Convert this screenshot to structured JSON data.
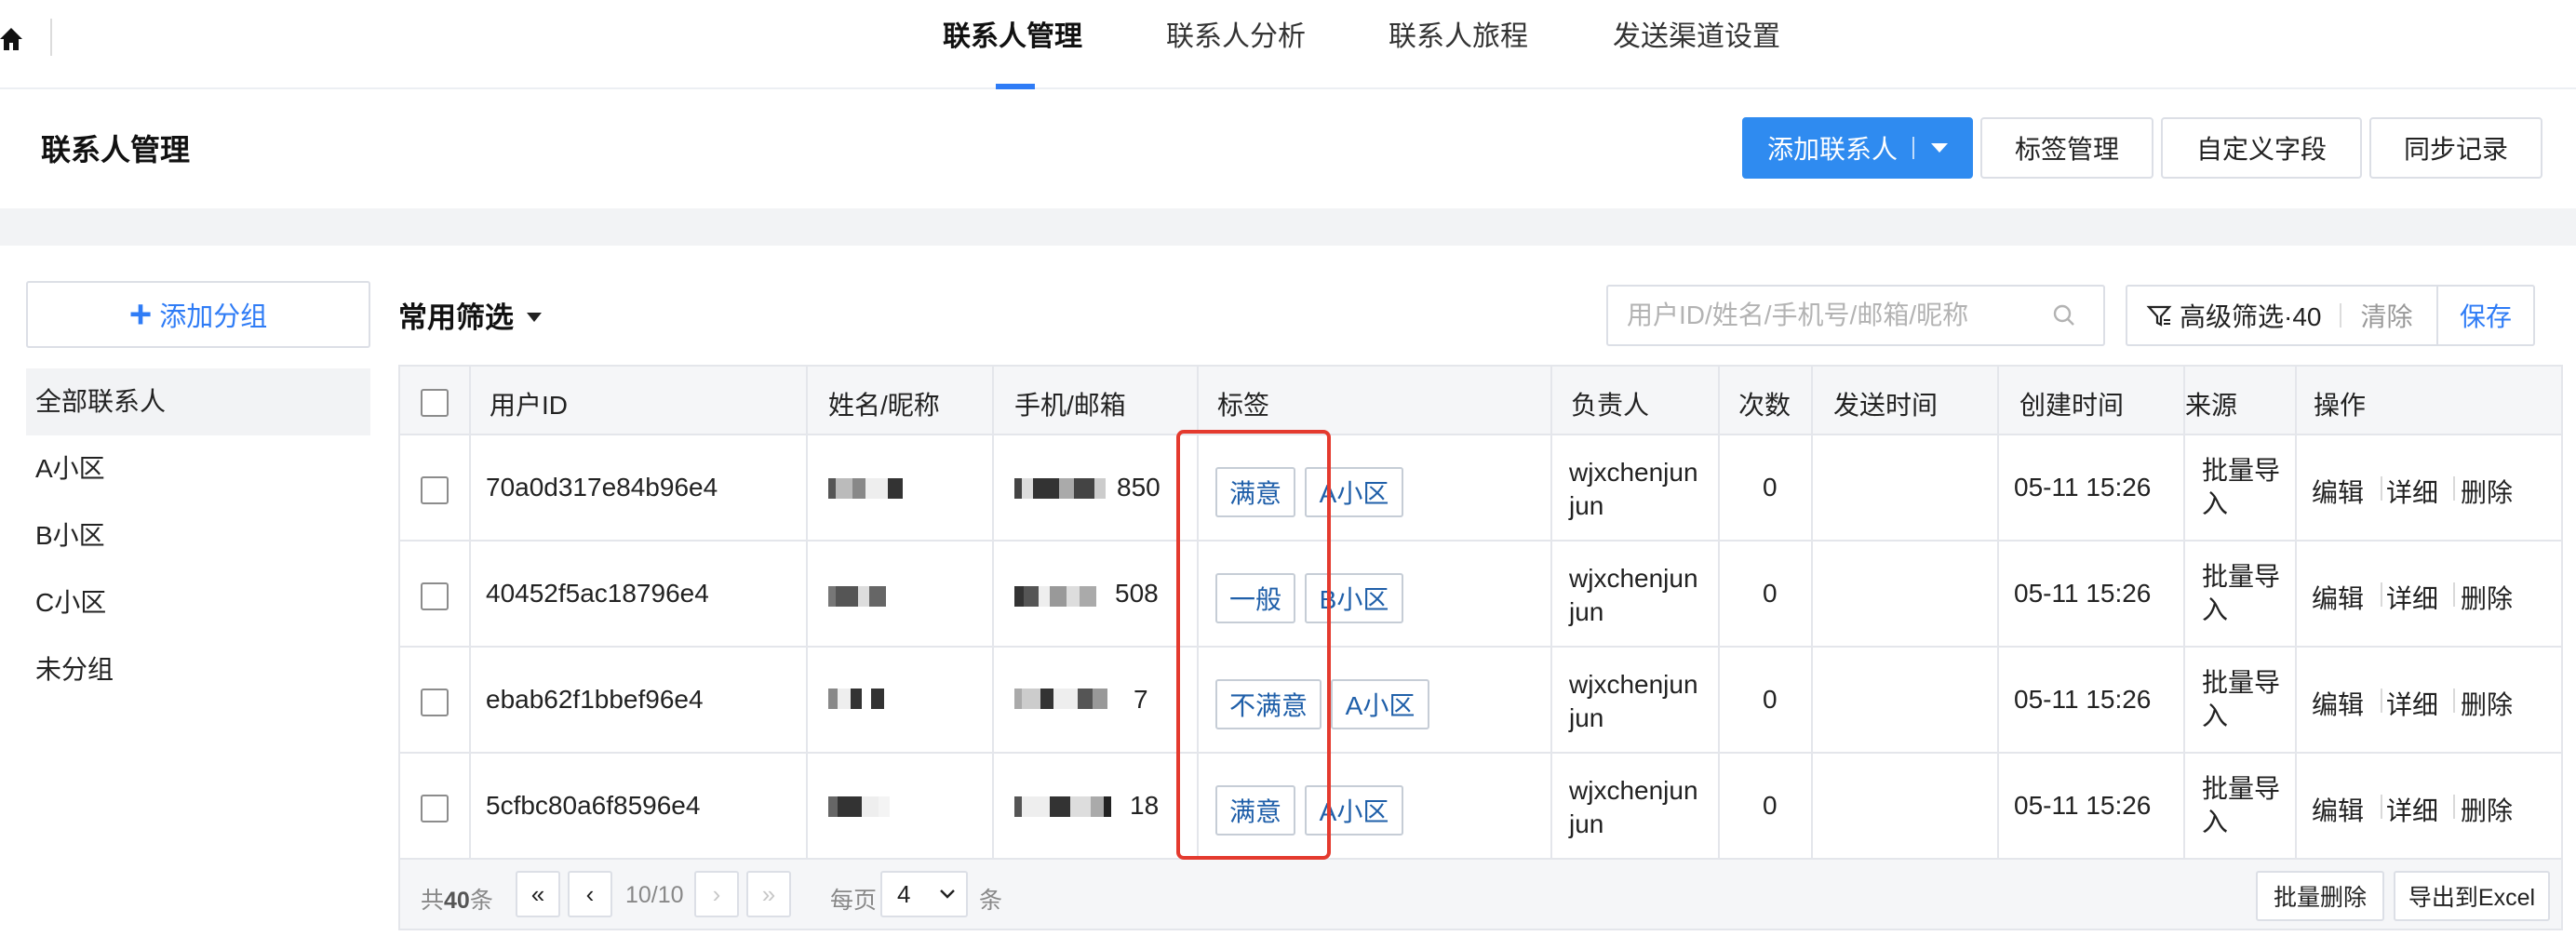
{
  "nav": {
    "tabs": [
      {
        "label": "联系人管理",
        "active": true
      },
      {
        "label": "联系人分析"
      },
      {
        "label": "联系人旅程"
      },
      {
        "label": "发送渠道设置"
      }
    ]
  },
  "header": {
    "title": "联系人管理",
    "add_contact": "添加联系人",
    "tag_manage": "标签管理",
    "custom_fields": "自定义字段",
    "sync_records": "同步记录"
  },
  "sidebar": {
    "add_group": "添加分组",
    "items": [
      {
        "label": "全部联系人",
        "active": true
      },
      {
        "label": "A小区"
      },
      {
        "label": "B小区"
      },
      {
        "label": "C小区"
      },
      {
        "label": "未分组"
      }
    ]
  },
  "filters": {
    "common": "常用筛选",
    "search_placeholder": "用户ID/姓名/手机号/邮箱/昵称",
    "advanced_label": "高级筛选·",
    "advanced_count": "40",
    "clear": "清除",
    "save": "保存"
  },
  "table": {
    "columns": [
      "用户ID",
      "姓名/昵称",
      "手机/邮箱",
      "标签",
      "负责人",
      "次数",
      "发送时间",
      "创建时间",
      "来源",
      "操作"
    ],
    "rows": [
      {
        "id": "70a0d317e84b96e4",
        "name_visible": "",
        "phone_visible": "850",
        "tags": [
          "满意",
          "A小区"
        ],
        "owner": "wjxchenjun jun",
        "owner_line1": "wjxchenjun",
        "owner_line2": "jun",
        "count": "0",
        "send_time": "",
        "created": "05-11 15:26",
        "source_line1": "批量导",
        "source_line2": "入"
      },
      {
        "id": "40452f5ac18796e4",
        "name_visible": "",
        "phone_visible": "508",
        "tags": [
          "一般",
          "B小区"
        ],
        "owner": "wjxchenjun jun",
        "owner_line1": "wjxchenjun",
        "owner_line2": "jun",
        "count": "0",
        "send_time": "",
        "created": "05-11 15:26",
        "source_line1": "批量导",
        "source_line2": "入"
      },
      {
        "id": "ebab62f1bbef96e4",
        "name_visible": "",
        "phone_visible": "7",
        "tags": [
          "不满意",
          "A小区"
        ],
        "owner": "wjxchenjun jun",
        "owner_line1": "wjxchenjun",
        "owner_line2": "jun",
        "count": "0",
        "send_time": "",
        "created": "05-11 15:26",
        "source_line1": "批量导",
        "source_line2": "入"
      },
      {
        "id": "5cfbc80a6f8596e4",
        "name_visible": "",
        "phone_visible": "18",
        "tags": [
          "满意",
          "A小区"
        ],
        "owner": "wjxchenjun jun",
        "owner_line1": "wjxchenjun",
        "owner_line2": "jun",
        "count": "0",
        "send_time": "",
        "created": "05-11 15:26",
        "source_line1": "批量导",
        "source_line2": "入"
      }
    ],
    "actions": {
      "edit": "编辑",
      "detail": "详细",
      "delete": "删除"
    }
  },
  "footer": {
    "total_prefix": "共",
    "total_count": "40",
    "total_suffix": "条",
    "first": "«",
    "prev": "‹",
    "page_info": "10/10",
    "next": "›",
    "last": "»",
    "per_page_label": "每页",
    "per_page_value": "4",
    "per_page_unit": "条",
    "batch_delete": "批量删除",
    "export": "导出到Excel"
  },
  "colors": {
    "accent": "#2f8bf0",
    "highlight_border": "#e43a2e",
    "tag_text": "#1f5fa9"
  }
}
